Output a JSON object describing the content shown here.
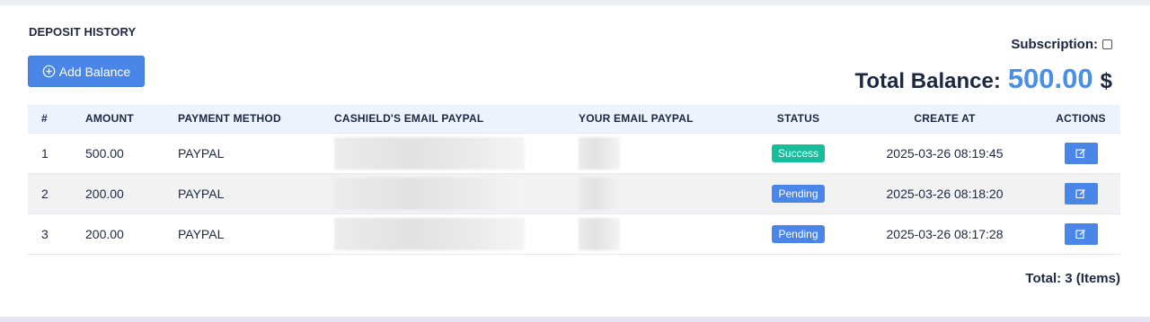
{
  "page": {
    "heading": "DEPOSIT HISTORY",
    "add_balance_label": "Add Balance",
    "subscription_label": "Subscription:",
    "total_balance_label": "Total Balance:",
    "total_balance_amount": "500.00",
    "total_balance_currency": "$",
    "footer_total": "Total: 3 (Items)"
  },
  "colors": {
    "primary": "#4a86e8",
    "success": "#18bd9b",
    "balance_amount": "#4a8fe7",
    "header_bg": "#edf3fc"
  },
  "table": {
    "columns": [
      "#",
      "AMOUNT",
      "PAYMENT METHOD",
      "CASHIELD'S EMAIL PAYPAL",
      "YOUR EMAIL PAYPAL",
      "STATUS",
      "CREATE AT",
      "ACTIONS"
    ],
    "rows": [
      {
        "num": "1",
        "amount": "500.00",
        "method": "PAYPAL",
        "status": "Success",
        "created": "2025-03-26 08:19:45",
        "action_icon": "edit-icon"
      },
      {
        "num": "2",
        "amount": "200.00",
        "method": "PAYPAL",
        "status": "Pending",
        "created": "2025-03-26 08:18:20",
        "action_icon": "edit-icon"
      },
      {
        "num": "3",
        "amount": "200.00",
        "method": "PAYPAL",
        "status": "Pending",
        "created": "2025-03-26 08:17:28",
        "action_icon": "edit-icon"
      }
    ]
  },
  "icons": {
    "add_balance": "plus-circle-icon",
    "action": "edit-icon"
  }
}
